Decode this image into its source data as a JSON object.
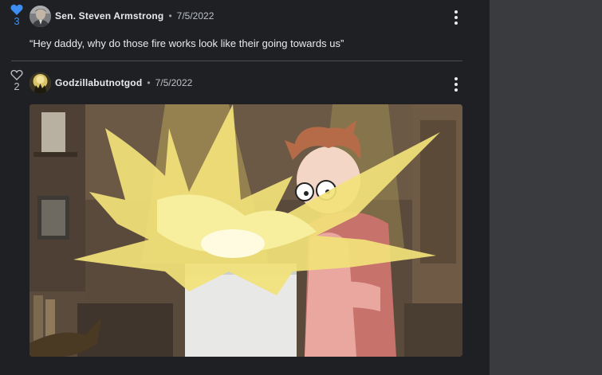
{
  "comments": [
    {
      "liked": true,
      "likes": "3",
      "username": "Sen. Steven Armstrong",
      "separator": "•",
      "date": "7/5/2022",
      "text": "“Hey daddy, why do those fire works look like their going towards us”"
    },
    {
      "liked": false,
      "likes": "2",
      "username": "Godzillabutnotgod",
      "separator": "•",
      "date": "7/5/2022",
      "text": ""
    }
  ],
  "icons": {
    "liked_heart": "heart-filled-icon",
    "heart": "heart-outline-icon",
    "more": "kebab-menu-icon"
  },
  "colors": {
    "background": "#1f2023",
    "like_active": "#3d8ef0",
    "side_panel": "#3a3b3e",
    "divider": "#4a4c50"
  }
}
